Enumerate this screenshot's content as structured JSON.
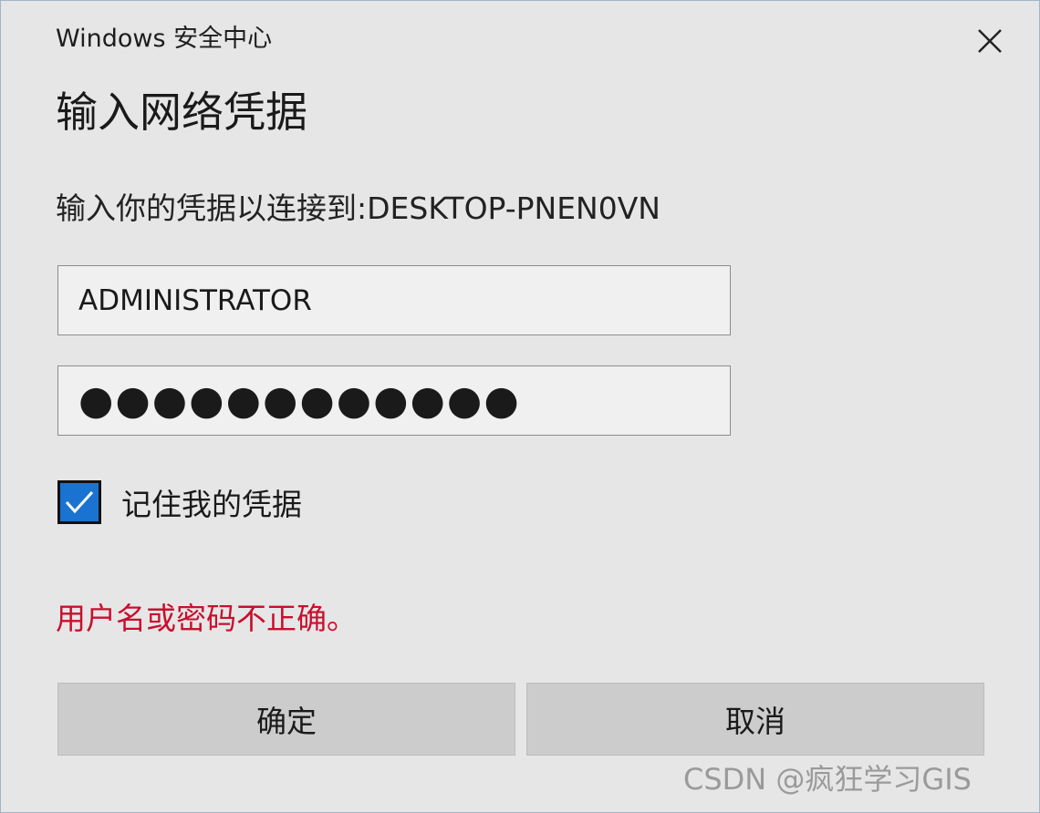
{
  "window": {
    "title": "Windows 安全中心",
    "close_icon": "close-icon"
  },
  "dialog": {
    "heading": "输入网络凭据",
    "prompt": "输入你的凭据以连接到:DESKTOP-PNEN0VN"
  },
  "username": {
    "value": "ADMINISTRATOR"
  },
  "password": {
    "masked_value": "●●●●●●●●●●●●"
  },
  "remember": {
    "checked": true,
    "label": "记住我的凭据",
    "check_icon": "checkmark-icon"
  },
  "error": {
    "message": "用户名或密码不正确。",
    "color": "#c8102e"
  },
  "buttons": {
    "ok_label": "确定",
    "cancel_label": "取消"
  },
  "watermark": {
    "text": "CSDN @疯狂学习GIS"
  },
  "colors": {
    "accent": "#1a73d1",
    "background": "#e6e6e6",
    "button": "#cccccc"
  }
}
